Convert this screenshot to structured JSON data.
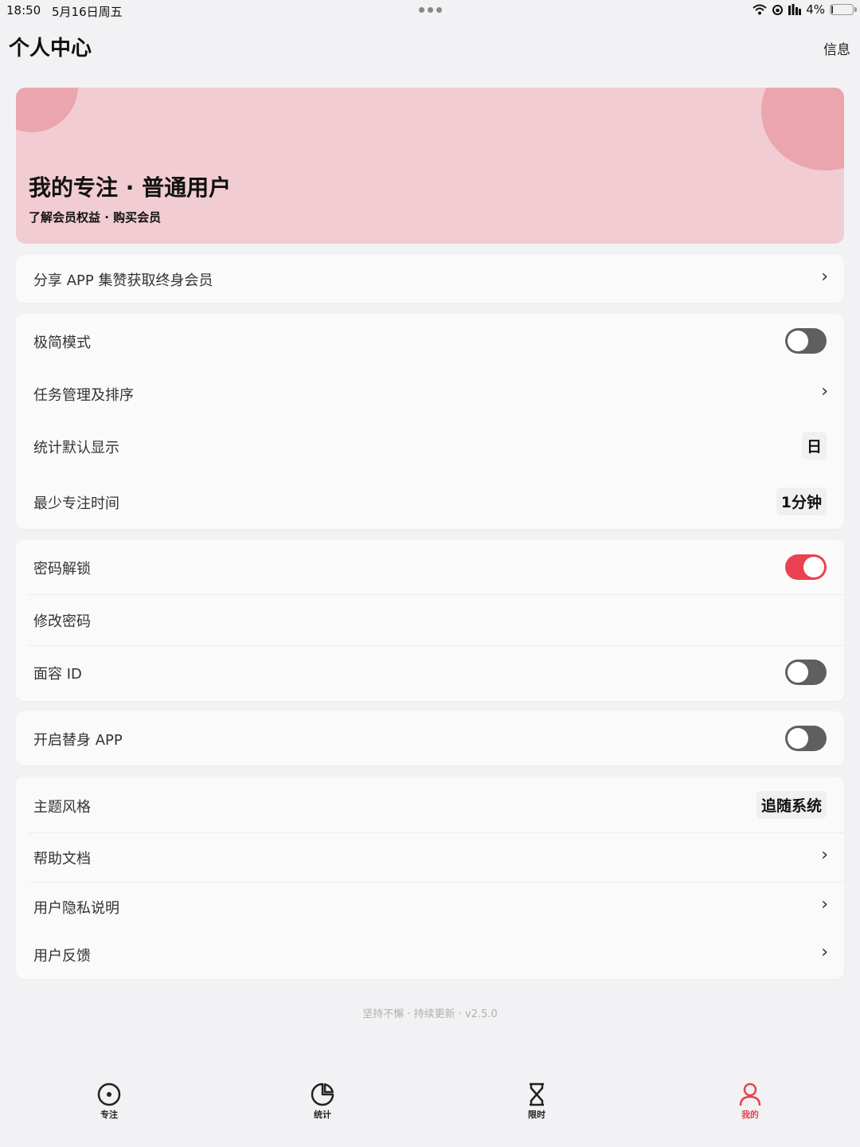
{
  "status": {
    "time": "18:50",
    "date": "5月16日周五",
    "battery": "4%",
    "battery_level": 0.04
  },
  "header": {
    "title": "个人中心",
    "link": "信息"
  },
  "banner": {
    "title": "我的专注 · 普通用户",
    "subtitle": "了解会员权益 · 购买会员",
    "color": "#f1ccd2"
  },
  "share": {
    "label": "分享 APP 集赞获取终身会员"
  },
  "settings1": {
    "minimal_mode": {
      "label": "极简模式",
      "on": false
    },
    "task_manage": {
      "label": "任务管理及排序"
    },
    "stats_default": {
      "label": "统计默认显示",
      "value": "日"
    },
    "min_focus": {
      "label": "最少专注时间",
      "value": "1分钟"
    }
  },
  "security": {
    "password_unlock": {
      "label": "密码解锁",
      "on": true
    },
    "change_password": {
      "label": "修改密码"
    },
    "face_id": {
      "label": "面容 ID",
      "on": false
    }
  },
  "alt_app": {
    "label": "开启替身 APP",
    "on": false
  },
  "misc": {
    "theme": {
      "label": "主题风格",
      "value": "追随系统"
    },
    "help": {
      "label": "帮助文档"
    },
    "privacy": {
      "label": "用户隐私说明"
    },
    "feedback": {
      "label": "用户反馈"
    }
  },
  "footer": "坚持不懈 · 持续更新 · v2.5.0",
  "tabs": [
    {
      "label": "专注",
      "icon": "focus-icon"
    },
    {
      "label": "统计",
      "icon": "pie-chart-icon"
    },
    {
      "label": "限时",
      "icon": "hourglass-icon"
    },
    {
      "label": "我的",
      "icon": "person-icon",
      "active": true
    }
  ],
  "colors": {
    "accent": "#e24550",
    "toggle_on": "#eb4151"
  }
}
